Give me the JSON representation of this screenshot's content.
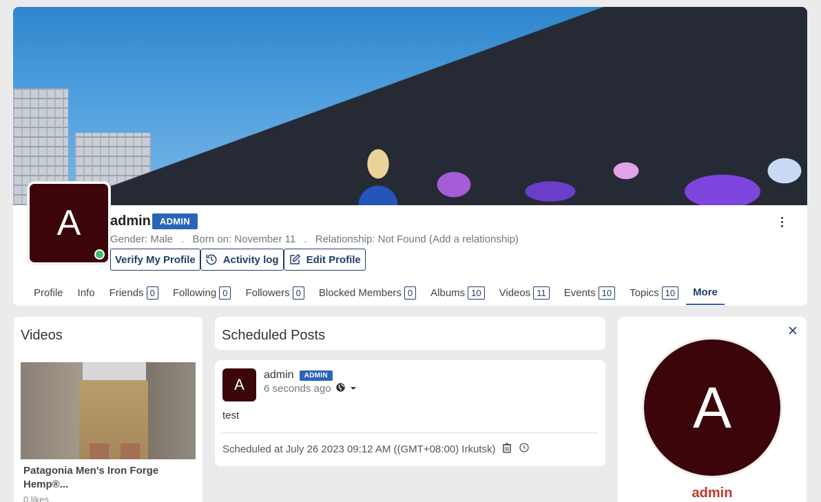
{
  "profile": {
    "avatar_letter": "A",
    "username": "admin",
    "role_badge": "ADMIN",
    "gender": "Gender: Male",
    "born": "Born on: November 11",
    "relationship": "Relationship: Not Found (Add a relationship)",
    "separator": "."
  },
  "actions": {
    "verify": "Verify My Profile",
    "activity": "Activity log",
    "edit": "Edit Profile"
  },
  "tabs": [
    {
      "label": "Profile",
      "count": ""
    },
    {
      "label": "Info",
      "count": ""
    },
    {
      "label": "Friends",
      "count": "0"
    },
    {
      "label": "Following",
      "count": "0"
    },
    {
      "label": "Followers",
      "count": "0"
    },
    {
      "label": "Blocked Members",
      "count": "0"
    },
    {
      "label": "Albums",
      "count": "10"
    },
    {
      "label": "Videos",
      "count": "11"
    },
    {
      "label": "Events",
      "count": "10"
    },
    {
      "label": "Topics",
      "count": "10"
    },
    {
      "label": "More",
      "count": ""
    }
  ],
  "videos_panel": {
    "title": "Videos",
    "video_title": "Patagonia Men's Iron Forge Hemp®...",
    "likes": "0 likes"
  },
  "scheduled": {
    "title": "Scheduled Posts",
    "post": {
      "avatar_letter": "A",
      "author": "admin",
      "badge": "ADMIN",
      "time": "6 seconds ago",
      "text": "test",
      "scheduled_at": "Scheduled at July 26 2023 09:12 AM ((GMT+08:00) Irkutsk)"
    }
  },
  "side_panel": {
    "avatar_letter": "A",
    "name": "admin"
  },
  "colors": {
    "accent": "#2a64b8",
    "dark_navy": "#1f3d6a",
    "avatar_bg": "#3b0509",
    "online": "#3fbf6f",
    "name_red": "#c0392b"
  }
}
